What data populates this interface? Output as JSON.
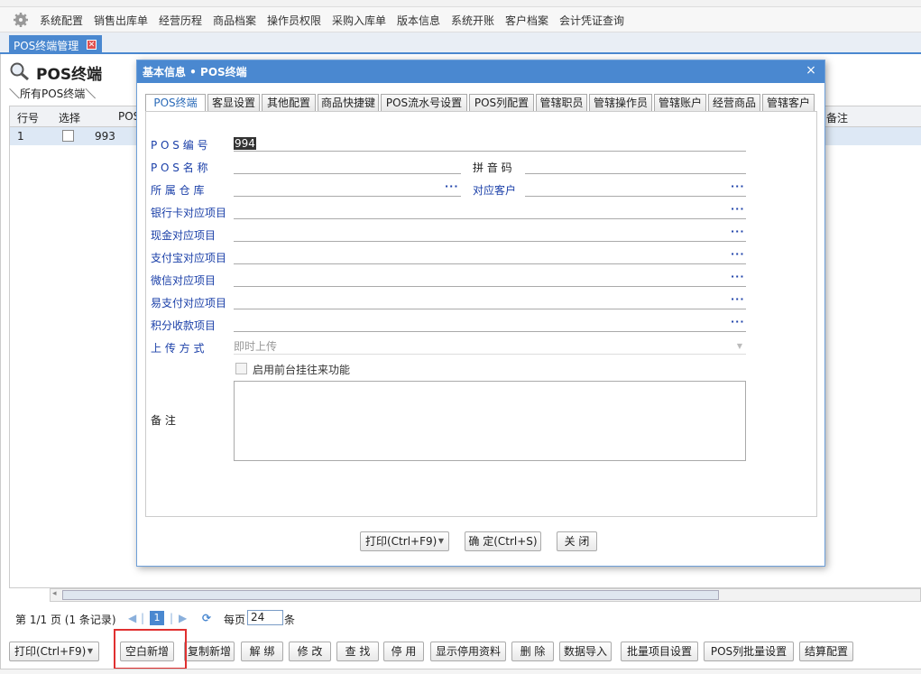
{
  "toolbar": {
    "items": [
      "系统配置",
      "销售出库单",
      "经营历程",
      "商品档案",
      "操作员权限",
      "采购入库单",
      "版本信息",
      "系统开账",
      "客户档案",
      "会计凭证查询"
    ]
  },
  "tab": {
    "label": "POS终端管理"
  },
  "page": {
    "title": "POS终端",
    "breadcrumb": "＼所有POS终端＼"
  },
  "grid": {
    "headers": [
      "行号",
      "选择",
      "POS",
      "备注"
    ],
    "rows": [
      {
        "line": "1",
        "pos": "993"
      }
    ]
  },
  "pager": {
    "page_info": "第 1/1 页 (1 条记录)",
    "current_page": "1",
    "per_page_label": "每页",
    "per_page": "24",
    "unit": "条"
  },
  "bottom_buttons": [
    "打印(Ctrl+F9)",
    "空白新增",
    "复制新增",
    "解 绑",
    "修 改",
    "查 找",
    "停 用",
    "显示停用资料",
    "删 除",
    "数据导入",
    "批量项目设置",
    "POS列批量设置",
    "结算配置"
  ],
  "dialog": {
    "title": "基本信息 • POS终端",
    "tabs": [
      "POS终端",
      "客显设置",
      "其他配置",
      "商品快捷键",
      "POS流水号设置",
      "POS列配置",
      "管辖职员",
      "管辖操作员",
      "管辖账户",
      "经营商品",
      "管辖客户"
    ],
    "fields": {
      "pos_no_label": "P O S 编 号",
      "pos_no_value": "994",
      "pos_name_label": "P O S 名 称",
      "pinyin_label": "拼 音 码",
      "warehouse_label": "所 属 仓 库",
      "customer_label": "对应客户",
      "bank_label": "银行卡对应项目",
      "cash_label": "现金对应项目",
      "alipay_label": "支付宝对应项目",
      "wechat_label": "微信对应项目",
      "yipay_label": "易支付对应项目",
      "points_label": "积分收款项目",
      "upload_label": "上 传 方 式",
      "upload_value": "即时上传",
      "checkbox_label": "启用前台挂往来功能",
      "remark_label": "备 注"
    },
    "buttons": {
      "print": "打印(Ctrl+F9)",
      "ok": "确 定(Ctrl+S)",
      "close": "关 闭"
    }
  }
}
